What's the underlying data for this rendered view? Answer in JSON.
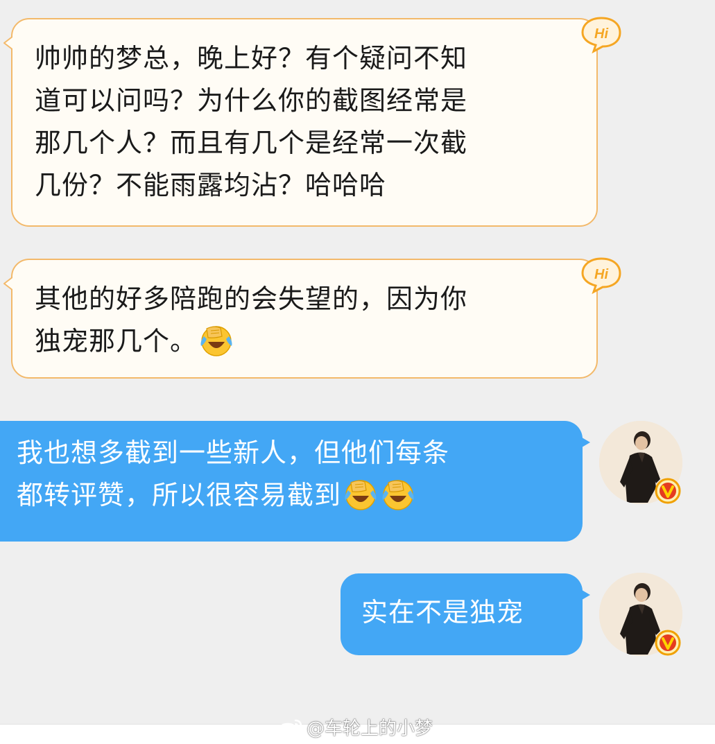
{
  "messages": [
    {
      "direction": "incoming",
      "badge": "Hi",
      "lines": [
        "帅帅的梦总，晚上好？有个疑问不知",
        "道可以问吗？为什么你的截图经常是",
        "那几个人？而且有几个是经常一次截",
        "几份？不能雨露均沾？哈哈哈"
      ]
    },
    {
      "direction": "incoming",
      "badge": "Hi",
      "lines": [
        "其他的好多陪跑的会失望的，因为你",
        "独宠那几个。"
      ],
      "trailing_emoji": "laughing-crying-face"
    },
    {
      "direction": "outgoing",
      "lines": [
        "我也想多截到一些新人，但他们每条",
        "都转评赞，所以很容易截到"
      ],
      "trailing_emoji": "laughing-crying-face",
      "emoji_count": 2
    },
    {
      "direction": "outgoing",
      "lines": [
        "实在不是独宠"
      ]
    }
  ],
  "watermark": "@车轮上的小梦",
  "colors": {
    "background": "#efefef",
    "incoming_bubble": "#fffcf5",
    "incoming_border": "#f3b96a",
    "outgoing_bubble": "#43a7f5",
    "badge_orange": "#f5a623",
    "verified_badge": "#f0a000"
  }
}
